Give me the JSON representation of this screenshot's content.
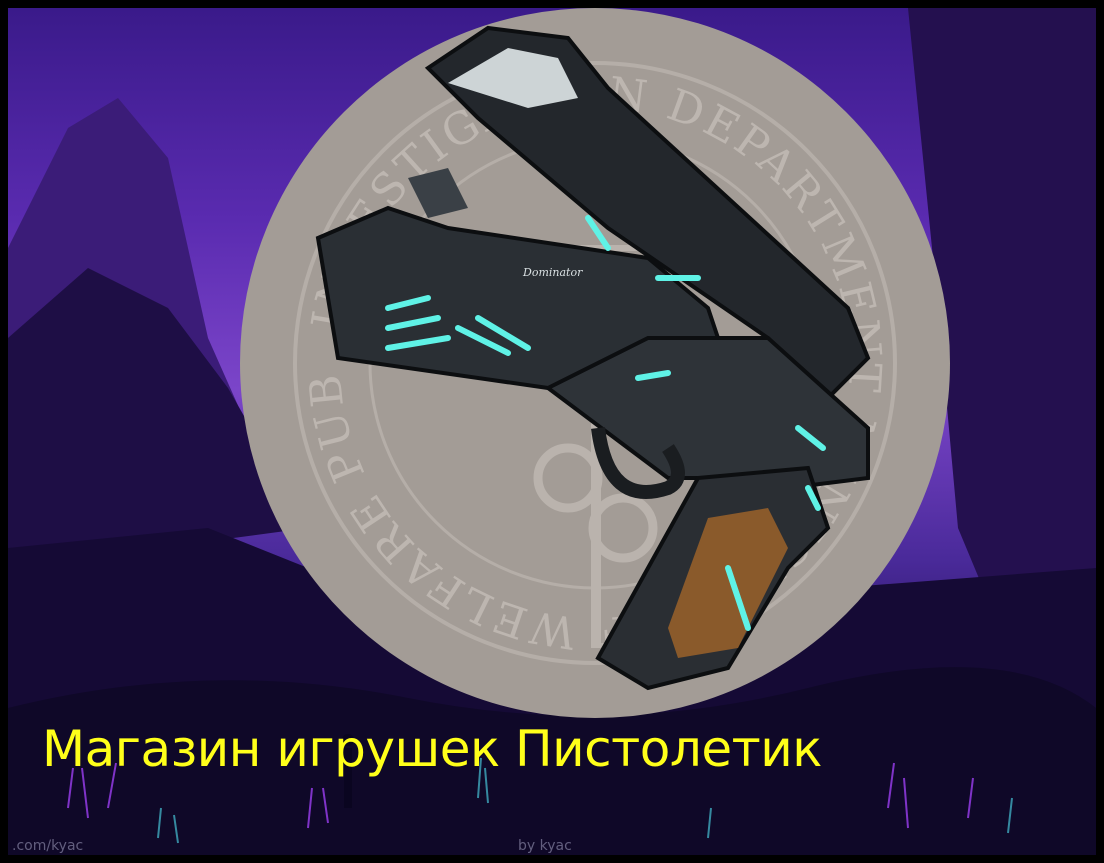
{
  "title": "Магазин игрушек Пистолетик",
  "seal_text": "INVESTIGATION DEPARTMENT MINISTRY OF WELFARE PUBLIC SAFETY BUREAU",
  "gun_inscription": "Dominator",
  "watermark_left": ".com/kyac",
  "watermark_right": "by kyac",
  "colors": {
    "title": "#ffff1a",
    "seal_bg": "#a39c96",
    "glow": "#5ff2e6",
    "sky": "#5a2bb0"
  }
}
